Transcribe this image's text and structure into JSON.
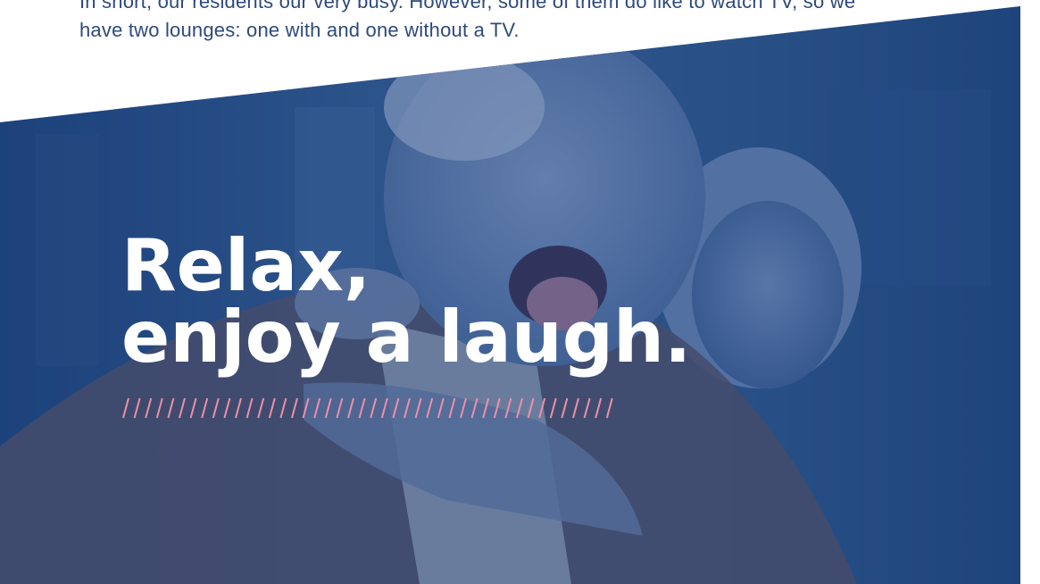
{
  "intro": {
    "line1": "In short, our residents our very busy. However, some of them do like to watch TV, so we",
    "line2": "have two lounges: one with and one without a TV."
  },
  "hero": {
    "heading_line1": "Relax,",
    "heading_line2": "enjoy a laugh.",
    "overlay_color": "#1c488c",
    "divider_color": "#f08fa8"
  }
}
